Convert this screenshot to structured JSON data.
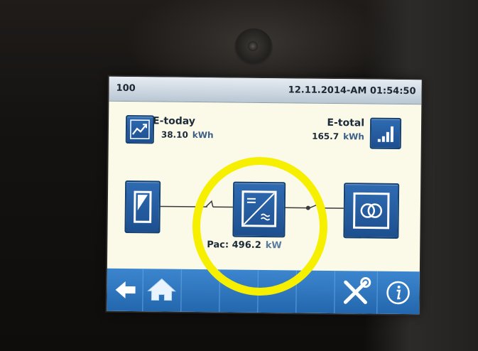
{
  "header": {
    "device_id": "100",
    "datetime": "12.11.2014-AM 01:54:50"
  },
  "energy": {
    "today": {
      "label": "E-today",
      "value": "38.10",
      "unit": "kWh",
      "icon": "line-chart-icon"
    },
    "total": {
      "label": "E-total",
      "value": "165.7",
      "unit": "kWh",
      "icon": "bar-chart-icon"
    }
  },
  "diagram": {
    "pv_icon": "solar-panel-icon",
    "inverter_icon": "inverter-icon",
    "grid_icon": "grid-transformer-icon",
    "pac_label": "Pac:",
    "pac_value": "496.2",
    "pac_unit": "kW"
  },
  "footer": {
    "buttons": [
      "back-arrow-icon",
      "home-icon",
      "tools-icon",
      "info-icon"
    ]
  },
  "colors": {
    "screen_bg": "#fbfae9",
    "tile_blue": "#2a63a8",
    "footer_blue": "#2f78c2",
    "highlight": "#f6ef00"
  }
}
